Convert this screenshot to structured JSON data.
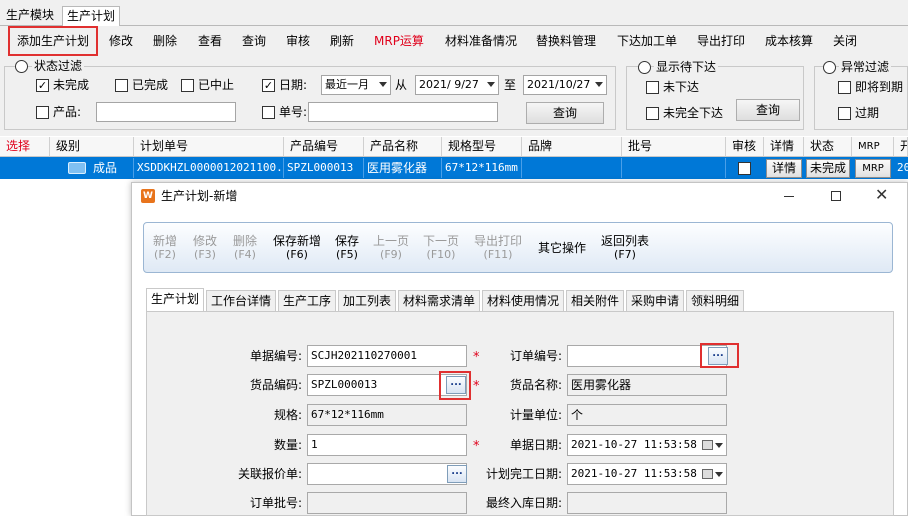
{
  "top_tabs": [
    "生产模块",
    "生产计划"
  ],
  "toolbar": [
    "添加生产计划",
    "修改",
    "删除",
    "查看",
    "查询",
    "审核",
    "刷新",
    "MRP运算",
    "材料准备情况",
    "替换料管理",
    "下达加工单",
    "导出打印",
    "成本核算",
    "关闭"
  ],
  "filter": {
    "status_title": "状态过滤",
    "unfinished": "未完成",
    "finished": "已完成",
    "suspended": "已中止",
    "date_label": "日期:",
    "date_range": "最近一月",
    "from_label": "从",
    "date_from": "2021/ 9/27",
    "to_label": "至",
    "date_to": "2021/10/27",
    "product_label": "产品:",
    "doc_label": "单号:",
    "query_btn": "查询",
    "show_pending_title": "显示待下达",
    "not_issued": "未下达",
    "not_fully_issued": "未完全下达",
    "query_btn2": "查询",
    "abnormal_title": "异常过滤",
    "near_due": "即将到期",
    "overdue": "过期"
  },
  "grid": {
    "headers": [
      "选择",
      "级别",
      "计划单号",
      "产品编号",
      "产品名称",
      "规格型号",
      "品牌",
      "批号",
      "审核",
      "详情",
      "状态",
      "MRP",
      "开"
    ],
    "row": {
      "level": "成品",
      "plan_no": "XSDDKHZL0000012021100...",
      "product_no": "SPZL000013",
      "product_name": "医用雾化器",
      "spec": "67*12*116mm",
      "detail_btn": "详情",
      "status_btn": "未完成",
      "mrp_btn": "MRP",
      "extra": "20"
    }
  },
  "dialog": {
    "title": "生产计划-新增",
    "toolbar": [
      {
        "label": "新增",
        "key": "(F2)",
        "enabled": false
      },
      {
        "label": "修改",
        "key": "(F3)",
        "enabled": false
      },
      {
        "label": "删除",
        "key": "(F4)",
        "enabled": false
      },
      {
        "label": "保存新增",
        "key": "(F6)",
        "enabled": true
      },
      {
        "label": "保存",
        "key": "(F5)",
        "enabled": true
      },
      {
        "label": "上一页",
        "key": "(F9)",
        "enabled": false
      },
      {
        "label": "下一页",
        "key": "(F10)",
        "enabled": false
      },
      {
        "label": "导出打印",
        "key": "(F11)",
        "enabled": false
      },
      {
        "label": "其它操作",
        "key": "",
        "enabled": true
      },
      {
        "label": "返回列表",
        "key": "(F7)",
        "enabled": true
      }
    ],
    "tabs": [
      "生产计划",
      "工作台详情",
      "生产工序",
      "加工列表",
      "材料需求清单",
      "材料使用情况",
      "相关附件",
      "采购申请",
      "领料明细"
    ],
    "form": {
      "doc_no_label": "单据编号:",
      "doc_no": "SCJH202110270001",
      "order_no_label": "订单编号:",
      "order_no": "",
      "goods_code_label": "货品编码:",
      "goods_code": "SPZL000013",
      "goods_name_label": "货品名称:",
      "goods_name": "医用雾化器",
      "spec_label": "规格:",
      "spec": "67*12*116mm",
      "unit_label": "计量单位:",
      "unit": "个",
      "qty_label": "数量:",
      "qty": "1",
      "doc_date_label": "单据日期:",
      "doc_date": "2021-10-27 11:53:58",
      "quote_label": "关联报价单:",
      "quote": "",
      "finish_date_label": "计划完工日期:",
      "finish_date": "2021-10-27 11:53:58",
      "order_batch_label": "订单批号:",
      "order_batch": "",
      "final_date_label": "最终入库日期:",
      "final_date": ""
    }
  },
  "colors": {
    "accent": "#0078d7",
    "highlight": "#e03030",
    "red_text": "#e0001b"
  }
}
